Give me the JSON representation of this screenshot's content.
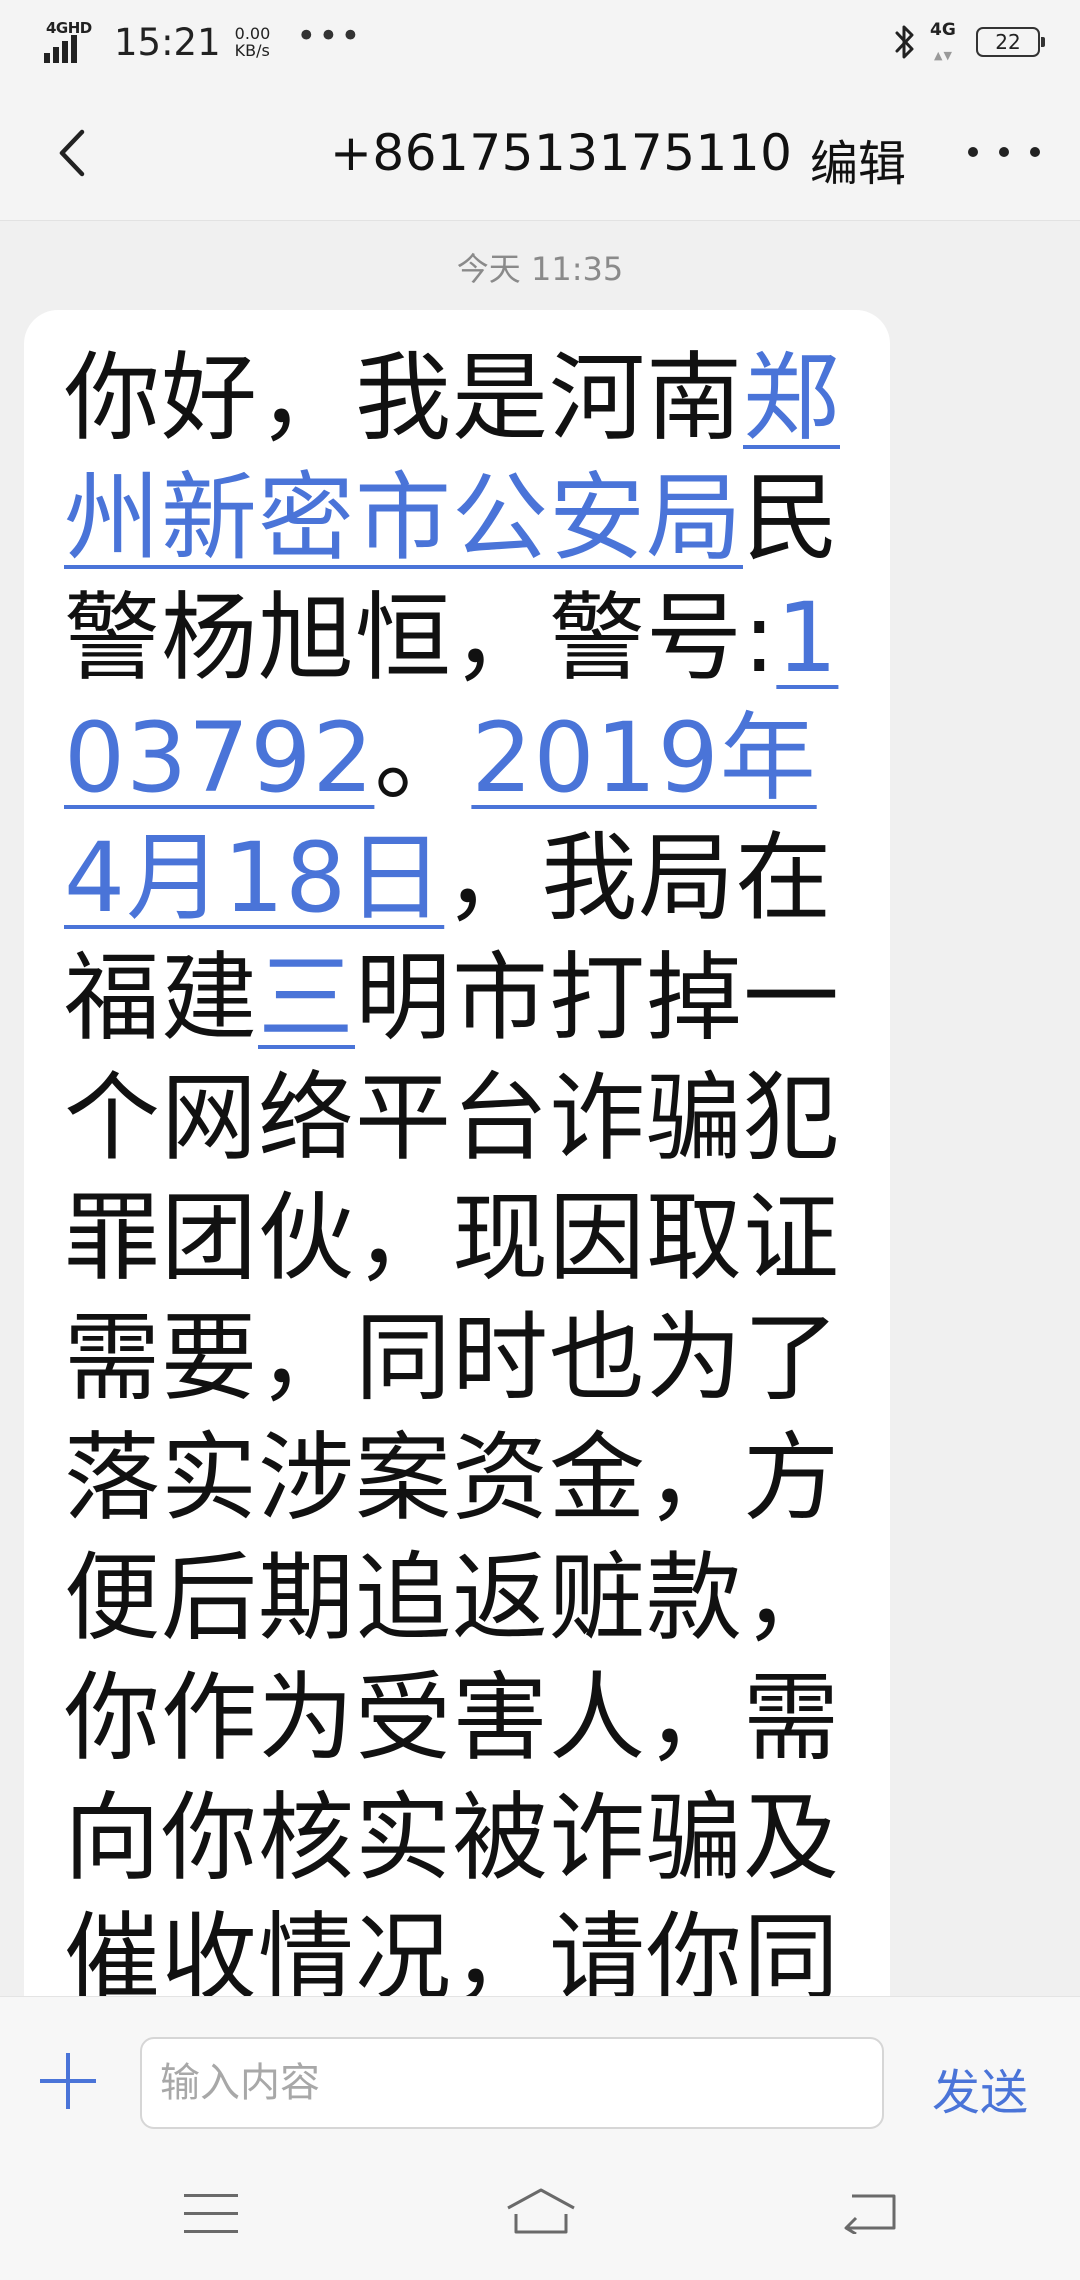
{
  "status_bar": {
    "network_label": "4GHD",
    "time": "15:21",
    "speed_value": "0.00",
    "speed_unit": "KB/s",
    "more_icon": "ellipsis-icon",
    "bluetooth_icon": "bluetooth-icon",
    "network_type": "4G",
    "battery_level": "22"
  },
  "header": {
    "back_icon": "chevron-left-icon",
    "contact": "+8617513175110",
    "edit_label": "编辑",
    "more_icon": "more-dots-icon"
  },
  "conversation": {
    "timestamp": "今天 11:35",
    "message": {
      "seg1": "你好，我是河南",
      "link1": "郑州新密市公安局",
      "seg2": "民警杨旭恒，警号:",
      "link2": "103792",
      "seg3": "。",
      "link3": "2019年4月18日",
      "seg4": "，我局在福建",
      "link4": "三",
      "seg5": "明市打掉一个网络平台诈骗犯罪团伙，现因取证需要，同时也为了落实涉案资金，方便后期追返赃款，你作为受害人，需向你核实被诈骗及催收情况，请你同"
    }
  },
  "input_bar": {
    "add_icon": "plus-icon",
    "placeholder": "输入内容",
    "send_label": "发送"
  },
  "nav_bar": {
    "menu_icon": "menu-icon",
    "home_icon": "home-icon",
    "back_icon": "back-arrow-icon"
  },
  "colors": {
    "accent": "#4a74d8",
    "background": "#f0f0f0",
    "bubble": "#ffffff",
    "text": "#111111",
    "muted": "#8a8a8a"
  }
}
